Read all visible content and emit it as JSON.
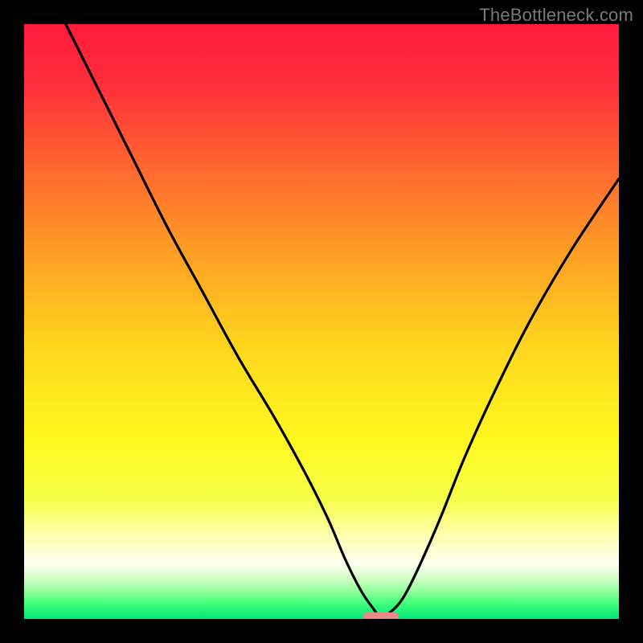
{
  "watermark": {
    "text": "TheBottleneck.com"
  },
  "chart_data": {
    "type": "line",
    "title": "",
    "xlabel": "",
    "ylabel": "",
    "xlim": [
      0,
      100
    ],
    "ylim": [
      0,
      100
    ],
    "grid": false,
    "series": [
      {
        "name": "bottleneck-curve",
        "x": [
          7,
          12,
          18,
          24,
          30,
          36,
          42,
          47,
          51,
          54,
          56.5,
          58.5,
          60,
          62,
          64,
          66.5,
          70,
          74,
          79,
          85,
          92,
          100
        ],
        "y": [
          100,
          90,
          78,
          66,
          55,
          44,
          34,
          25,
          17,
          10,
          5,
          2,
          0.5,
          1.5,
          4,
          9,
          17,
          27,
          38,
          50,
          62,
          74
        ]
      }
    ],
    "marker": {
      "name": "optimal-point",
      "x": 60,
      "y": 0.5,
      "color": "#e88a8a",
      "width": 6,
      "height": 1.2
    },
    "gradient_stops": [
      {
        "offset": 0.0,
        "color": "#ff1a3a"
      },
      {
        "offset": 0.1,
        "color": "#ff2e3a"
      },
      {
        "offset": 0.25,
        "color": "#ff6a2f"
      },
      {
        "offset": 0.4,
        "color": "#ffa423"
      },
      {
        "offset": 0.55,
        "color": "#ffd81e"
      },
      {
        "offset": 0.7,
        "color": "#fff81f"
      },
      {
        "offset": 0.8,
        "color": "#f6ff4a"
      },
      {
        "offset": 0.86,
        "color": "#ffffb0"
      },
      {
        "offset": 0.905,
        "color": "#fffff0"
      },
      {
        "offset": 0.93,
        "color": "#d6ffc9"
      },
      {
        "offset": 0.955,
        "color": "#8eff9a"
      },
      {
        "offset": 0.975,
        "color": "#3dff7a"
      },
      {
        "offset": 1.0,
        "color": "#00e87a"
      }
    ]
  }
}
